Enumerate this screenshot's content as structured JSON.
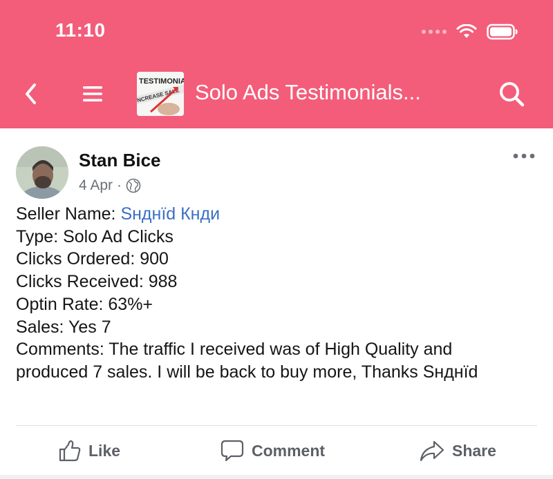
{
  "status_bar": {
    "time": "11:10"
  },
  "nav": {
    "title": "Solo Ads Testimonials...",
    "group_thumb_caption_top": "TESTIMONIAL",
    "group_thumb_caption_bottom": "NCREASE SALE",
    "icons": [
      "back-arrow-icon",
      "menu-icon",
      "search-icon"
    ]
  },
  "post": {
    "author": "Stan Bice",
    "date": "4 Apr",
    "separator": "·",
    "privacy_icon": "globe-icon",
    "more_icon": "more-dots-icon",
    "lines": {
      "seller_label": "Seller Name: ",
      "seller_name": "Sнднïd Кнди",
      "type": "Type: Solo Ad Clicks",
      "clicks_ordered": "Clicks Ordered: 900",
      "clicks_received": "Clicks Received: 988",
      "optin_rate": "Optin Rate: 63%+",
      "sales": "Sales: Yes 7",
      "comments_1": "Comments: The traffic I received was of High Quality and",
      "comments_2": "produced 7 sales. I will be back to buy more, Thanks Sнднïd"
    }
  },
  "actions": {
    "like": "Like",
    "comment": "Comment",
    "share": "Share"
  },
  "colors": {
    "header": "#f35d7a",
    "link": "#3b6fc4",
    "muted": "#6b6f75"
  }
}
